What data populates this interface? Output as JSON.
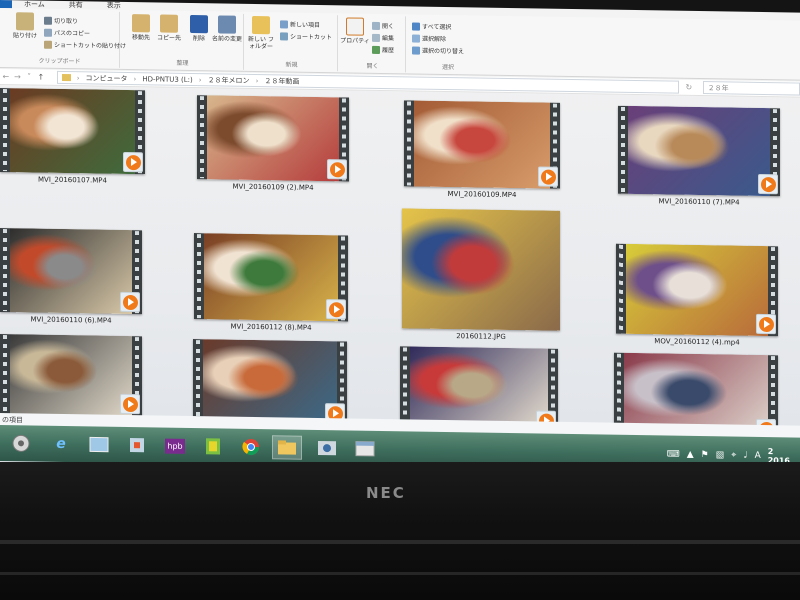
{
  "ribbon": {
    "tabs": [
      "ホーム",
      "共有",
      "表示"
    ],
    "file_tab": "",
    "groups": {
      "clipboard_label": "クリップボード",
      "organize_label": "整理",
      "new_label": "新規",
      "open_label": "開く",
      "select_label": "選択"
    },
    "items": {
      "copy_path": "パスのコピー",
      "paste_shortcut": "ショートカットの貼り付け",
      "cut": "切り取り",
      "paste": "貼り付け",
      "move_to": "移動先",
      "copy_to": "コピー先",
      "delete": "削除",
      "rename": "名前の変更",
      "new_folder": "新しい フォルダー",
      "new_item": "新しい項目",
      "shortcut": "ショートカット",
      "properties": "プロパティ",
      "open": "開く",
      "edit": "編集",
      "history": "履歴",
      "select_all": "すべて選択",
      "select_none": "選択解除",
      "invert_selection": "選択の切り替え"
    }
  },
  "address": {
    "crumbs": [
      "コンピュータ",
      "HD-PNTU3 (L:)",
      "２８年メロン",
      "２８年動画"
    ],
    "search_placeholder": "２８年"
  },
  "files": [
    {
      "name": "MVI_20160107.MP4",
      "type": "video"
    },
    {
      "name": "MVI_20160109 (2).MP4",
      "type": "video"
    },
    {
      "name": "MVI_20160109.MP4",
      "type": "video"
    },
    {
      "name": "MVI_20160110 (7).MP4",
      "type": "video"
    },
    {
      "name": "MVI_20160110 (6).MP4",
      "type": "video"
    },
    {
      "name": "MVI_20160112 (8).MP4",
      "type": "video"
    },
    {
      "name": "20160112.JPG",
      "type": "image"
    },
    {
      "name": "MOV_20160112 (4).mp4",
      "type": "video"
    },
    {
      "name": "",
      "type": "video"
    },
    {
      "name": "",
      "type": "video"
    },
    {
      "name": "",
      "type": "video"
    },
    {
      "name": "",
      "type": "video"
    }
  ],
  "status": {
    "item_count": "の項目"
  },
  "taskbar": {
    "icons": [
      "start-icon",
      "ie-icon",
      "explorer-app-icon",
      "paint-icon",
      "hpb-icon",
      "app-green-icon",
      "chrome-icon",
      "folder-icon",
      "photo-icon",
      "window-icon"
    ],
    "hpb_label": "hpb"
  },
  "tray": {
    "time": "2",
    "date": "2016"
  },
  "brand": "NEC"
}
